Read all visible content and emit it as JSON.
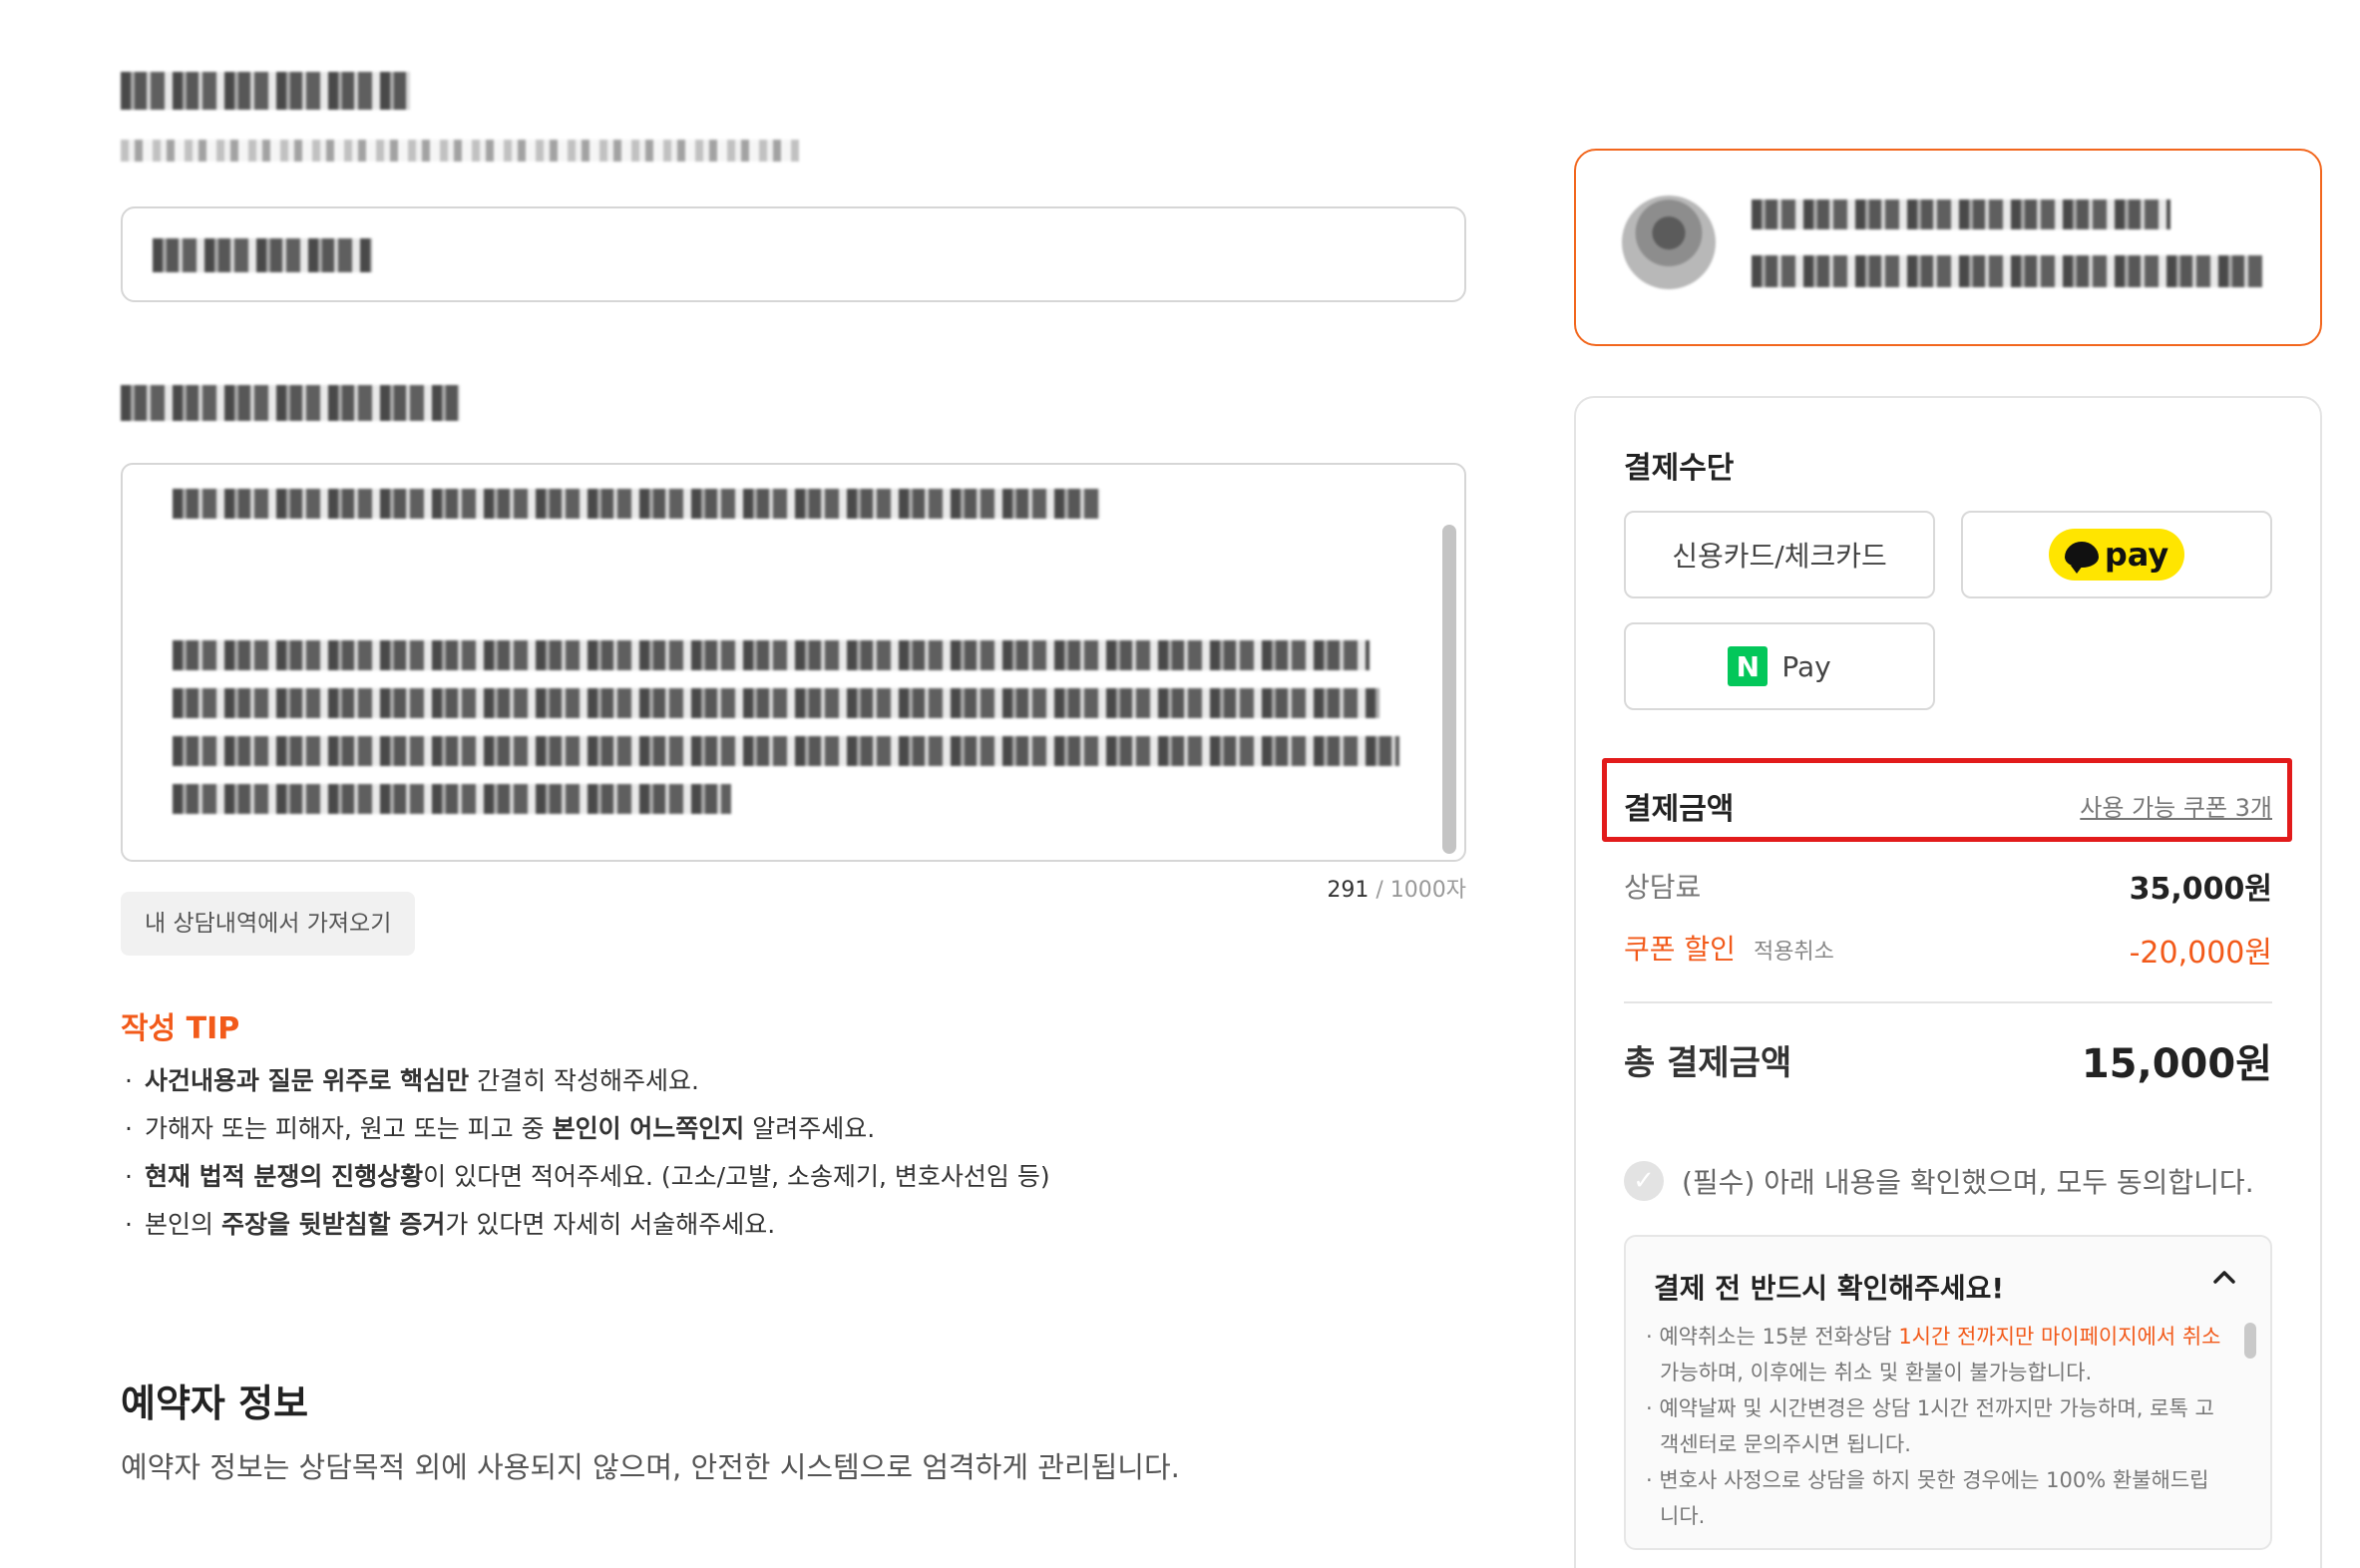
{
  "textarea": {
    "char_count": "291",
    "char_max": " / 1000자"
  },
  "history_button": "내 상담내역에서 가져오기",
  "tip": {
    "title": "작성 TIP",
    "items": [
      {
        "bold": "사건내용과 질문 위주로 핵심만",
        "rest": " 간결히 작성해주세요."
      },
      {
        "pre": "가해자 또는 피해자, 원고 또는 피고 중 ",
        "bold": "본인이 어느쪽인지",
        "rest": " 알려주세요."
      },
      {
        "bold": "현재 법적 분쟁의 진행상황",
        "rest": "이 있다면 적어주세요. (고소/고발, 소송제기, 변호사선임 등)"
      },
      {
        "pre": "본인의 ",
        "bold": "주장을 뒷받침할 증거",
        "rest": "가 있다면 자세히 서술해주세요."
      }
    ]
  },
  "booker": {
    "title": "예약자 정보",
    "description": "예약자 정보는 상담목적 외에 사용되지 않으며, 안전한 시스템으로 엄격하게 관리됩니다."
  },
  "payment": {
    "method_title": "결제수단",
    "methods": {
      "card": "신용카드/체크카드",
      "kakao": "pay",
      "naver": "Pay"
    },
    "amount_title": "결제금액",
    "coupon_link": "사용 가능 쿠폰 3개",
    "fee_label": "상담료",
    "fee_value": "35,000원",
    "discount_label": "쿠폰 할인",
    "discount_cancel": "적용취소",
    "discount_value": "-20,000원",
    "total_label": "총 결제금액",
    "total_value": "15,000원",
    "agree_text": "(필수) 아래 내용을 확인했으며, 모두 동의합니다.",
    "notice": {
      "title": "결제 전 반드시 확인해주세요!",
      "items": [
        {
          "pre": "· 예약취소는 15분 전화상담 ",
          "highlight": "1시간 전까지만 마이페이지에서 취소",
          "rest": " 가능하며, 이후에는 취소 및 환불이 불가능합니다."
        },
        {
          "pre": "· 예약날짜 및 시간변경은 상담 1시간 전까지만 가능하며, 로톡 고객센터로 문의주시면 됩니다.",
          "highlight": "",
          "rest": ""
        },
        {
          "pre": "· 변호사 사정으로 상담을 하지 못한 경우에는 100% 환불해드립니다.",
          "highlight": "",
          "rest": ""
        }
      ]
    }
  },
  "colors": {
    "accent": "#f25a1a",
    "highlight_box": "#e21b1b",
    "kakao": "#ffe500",
    "naver": "#03c75a"
  }
}
